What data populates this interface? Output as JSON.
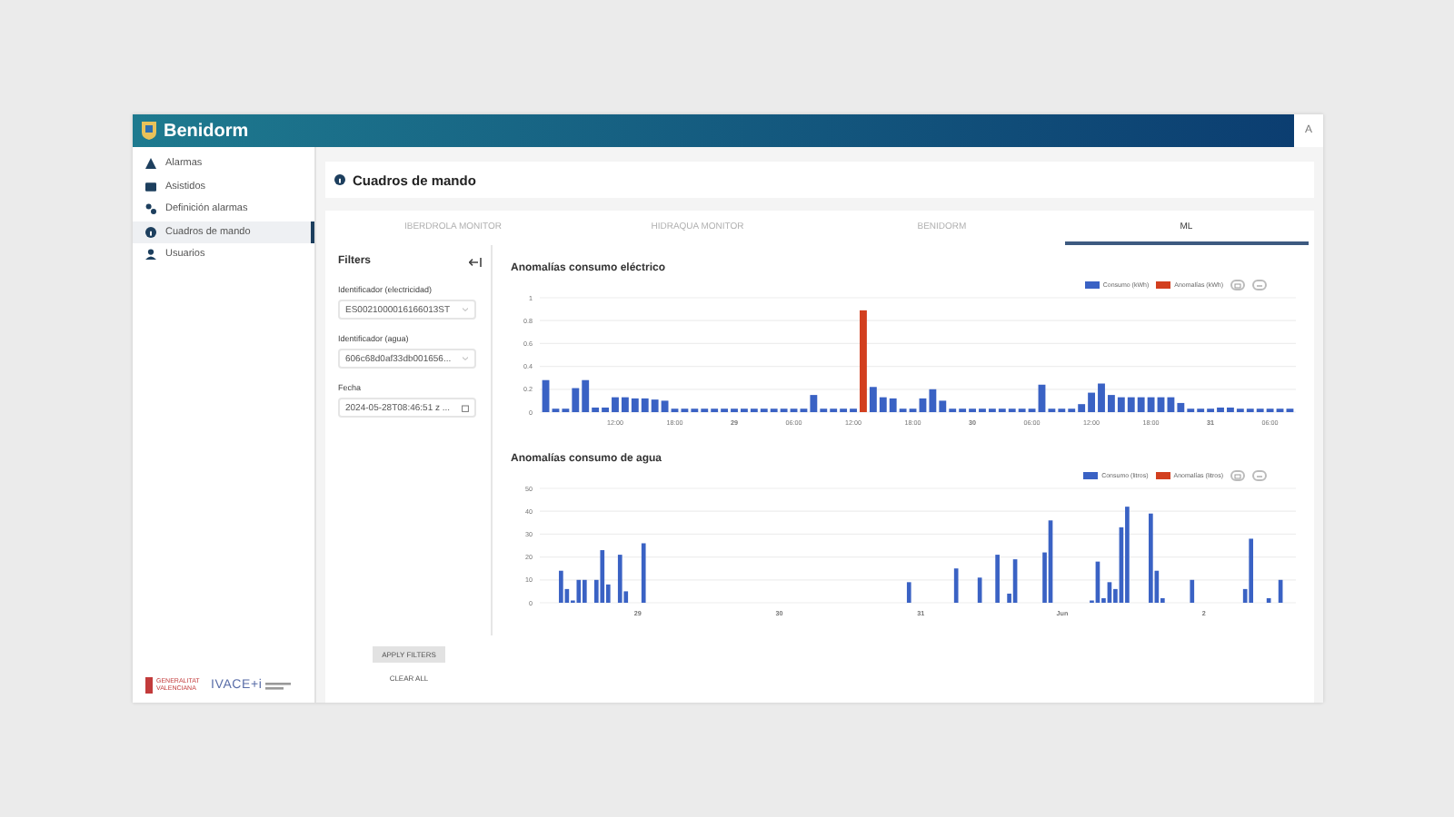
{
  "header": {
    "title": "Benidorm",
    "avatar": "A"
  },
  "sidebar": {
    "items": [
      {
        "label": "Alarmas",
        "kind": "warning",
        "selected": false
      },
      {
        "label": "Asistidos",
        "kind": "card",
        "selected": false
      },
      {
        "label": "Definición alarmas",
        "kind": "gears",
        "selected": false
      },
      {
        "label": "Cuadros de mando",
        "kind": "info",
        "selected": true
      },
      {
        "label": "Usuarios",
        "kind": "user",
        "selected": false
      }
    ],
    "footer_logos": [
      {
        "text": "GENERALITAT VALENCIANA",
        "kind": "gva"
      },
      {
        "text": "IVACE+i",
        "kind": "ivace"
      }
    ]
  },
  "page_title": "Cuadros de mando",
  "tabs": [
    {
      "label": "IBERDROLA MONITOR",
      "selected": false
    },
    {
      "label": "HIDRAQUA MONITOR",
      "selected": false
    },
    {
      "label": "BENIDORM",
      "selected": false
    },
    {
      "label": "ML",
      "selected": true
    }
  ],
  "filters": {
    "title": "Filters",
    "fields": [
      {
        "label": "Identificador (electricidad)",
        "value": "ES0021000016166013ST",
        "kind": "select"
      },
      {
        "label": "Identificador (agua)",
        "value": "606c68d0af33db001656...",
        "kind": "select"
      },
      {
        "label": "Fecha",
        "value": "2024-05-28T08:46:51 z ...",
        "kind": "date"
      }
    ],
    "apply": "APPLY FILTERS",
    "clear": "CLEAR ALL"
  },
  "charts": [
    {
      "chart_data": {
        "type": "bar",
        "title": "Anomalías consumo eléctrico",
        "stacked": true,
        "grid": true,
        "categories": [
          null,
          null,
          null,
          null,
          null,
          null,
          null,
          "12:00",
          null,
          null,
          null,
          null,
          null,
          "18:00",
          null,
          null,
          null,
          null,
          null,
          "29",
          null,
          null,
          null,
          null,
          null,
          "06:00",
          null,
          null,
          null,
          null,
          null,
          "12:00",
          null,
          null,
          null,
          null,
          null,
          "18:00",
          null,
          null,
          null,
          null,
          null,
          "30",
          null,
          null,
          null,
          null,
          null,
          "06:00",
          null,
          null,
          null,
          null,
          null,
          "12:00",
          null,
          null,
          null,
          null,
          null,
          "18:00",
          null,
          null,
          null,
          null,
          null,
          "31",
          null,
          null,
          null,
          null,
          null,
          "06:00",
          null,
          null
        ],
        "series": [
          {
            "name": "Consumo (kWh)",
            "color": "#3a62c4",
            "values": [
              0.28,
              0.03,
              0.03,
              0.21,
              0.28,
              0.04,
              0.04,
              0.13,
              0.13,
              0.12,
              0.12,
              0.11,
              0.1,
              0.03,
              0.03,
              0.03,
              0.03,
              0.03,
              0.03,
              0.03,
              0.03,
              0.03,
              0.03,
              0.03,
              0.03,
              0.03,
              0.03,
              0.15,
              0.03,
              0.03,
              0.03,
              0.03,
              null,
              0.22,
              0.13,
              0.12,
              0.03,
              0.03,
              0.12,
              0.2,
              0.1,
              0.03,
              0.03,
              0.03,
              0.03,
              0.03,
              0.03,
              0.03,
              0.03,
              0.03,
              0.24,
              0.03,
              0.03,
              0.03,
              0.07,
              0.17,
              0.25,
              0.15,
              0.13,
              0.13,
              0.13,
              0.13,
              0.13,
              0.13,
              0.08,
              0.03,
              0.03,
              0.03,
              0.04,
              0.04,
              0.03,
              0.03,
              0.03,
              0.03,
              0.03,
              0.03
            ]
          },
          {
            "name": "Anomalías (kWh)",
            "color": "#d23f1f",
            "values": [
              null,
              null,
              null,
              null,
              null,
              null,
              null,
              null,
              null,
              null,
              null,
              null,
              null,
              null,
              null,
              null,
              null,
              null,
              null,
              null,
              null,
              null,
              null,
              null,
              null,
              null,
              null,
              null,
              null,
              null,
              null,
              null,
              0.89,
              null,
              null,
              null,
              null,
              null,
              null,
              null,
              null,
              null,
              null,
              null,
              null,
              null,
              null,
              null,
              null,
              null,
              null,
              null,
              null,
              null,
              null,
              null,
              null,
              null,
              null,
              null,
              null,
              null,
              null,
              null,
              null,
              null,
              null,
              null,
              null,
              null,
              null,
              null,
              null,
              null,
              null,
              null
            ]
          }
        ],
        "ylim": [
          0,
          1
        ],
        "yticks": [
          {
            "value": 0,
            "label": "0"
          },
          {
            "value": 0.2,
            "label": "0.2"
          },
          {
            "value": 0.4,
            "label": "0.4"
          },
          {
            "value": 0.6,
            "label": "0.6"
          },
          {
            "value": 0.8,
            "label": "0.8"
          },
          {
            "value": 1,
            "label": "1"
          }
        ]
      }
    },
    {
      "chart_data": {
        "type": "bar",
        "title": "Anomalías consumo de agua",
        "stacked": true,
        "grid": true,
        "categories": [
          null,
          null,
          null,
          null,
          null,
          null,
          null,
          null,
          null,
          null,
          null,
          null,
          null,
          null,
          null,
          null,
          "29",
          null,
          null,
          null,
          null,
          null,
          null,
          null,
          null,
          null,
          null,
          null,
          null,
          null,
          null,
          null,
          null,
          null,
          null,
          null,
          null,
          null,
          null,
          null,
          "30",
          null,
          null,
          null,
          null,
          null,
          null,
          null,
          null,
          null,
          null,
          null,
          null,
          null,
          null,
          null,
          null,
          null,
          null,
          null,
          null,
          null,
          null,
          null,
          "31",
          null,
          null,
          null,
          null,
          null,
          null,
          null,
          null,
          null,
          null,
          null,
          null,
          null,
          null,
          null,
          null,
          null,
          null,
          null,
          null,
          null,
          null,
          null,
          "Jun",
          null,
          null,
          null,
          null,
          null,
          null,
          null,
          null,
          null,
          null,
          null,
          null,
          null,
          null,
          null,
          null,
          null,
          null,
          null,
          null,
          null,
          null,
          null,
          "2",
          null,
          null,
          null,
          null,
          null,
          null,
          null,
          null,
          null,
          null,
          null,
          null,
          null,
          null,
          null
        ],
        "series": [
          {
            "name": "Consumo (litros)",
            "color": "#3a62c4",
            "values": [
              null,
              null,
              null,
              14,
              6,
              1,
              10,
              10,
              null,
              10,
              23,
              8,
              null,
              21,
              5,
              null,
              null,
              26,
              null,
              null,
              null,
              null,
              null,
              null,
              null,
              null,
              null,
              null,
              null,
              null,
              null,
              null,
              null,
              null,
              null,
              null,
              null,
              null,
              null,
              null,
              null,
              null,
              null,
              null,
              null,
              null,
              null,
              null,
              null,
              null,
              null,
              null,
              null,
              null,
              null,
              null,
              null,
              null,
              null,
              null,
              null,
              null,
              9,
              null,
              null,
              null,
              null,
              null,
              null,
              null,
              15,
              null,
              null,
              null,
              11,
              null,
              null,
              21,
              null,
              4,
              19,
              null,
              null,
              null,
              null,
              22,
              36,
              null,
              null,
              null,
              null,
              null,
              null,
              1,
              18,
              2,
              9,
              6,
              33,
              42,
              null,
              null,
              null,
              39,
              14,
              2,
              null,
              null,
              null,
              null,
              10,
              null,
              null,
              null,
              null,
              null,
              null,
              null,
              null,
              6,
              28,
              null,
              null,
              2,
              null,
              10,
              null,
              null
            ]
          },
          {
            "name": "Anomalías (litros)",
            "color": "#d23f1f",
            "values": [
              null,
              null,
              null,
              null,
              null,
              null,
              null,
              null,
              null,
              null,
              null,
              null,
              null,
              null,
              null,
              null,
              null,
              null,
              null,
              null,
              null,
              null,
              null,
              null,
              null,
              null,
              null,
              null,
              null,
              null,
              null,
              null,
              null,
              null,
              null,
              null,
              null,
              null,
              null,
              null,
              null,
              null,
              null,
              null,
              null,
              null,
              null,
              null,
              null,
              null,
              null,
              null,
              null,
              null,
              null,
              null,
              null,
              null,
              null,
              null,
              null,
              null,
              null,
              null,
              null,
              null,
              null,
              null,
              null,
              null,
              null,
              null,
              null,
              null,
              null,
              null,
              null,
              null,
              null,
              null,
              null,
              null,
              null,
              null,
              null,
              null,
              null,
              null,
              null,
              null,
              null,
              null,
              null,
              null,
              null,
              null,
              null,
              null,
              null,
              null,
              null,
              null,
              null,
              null,
              null,
              null,
              null,
              null,
              null,
              null,
              null,
              null,
              null,
              null,
              null,
              null,
              null,
              null,
              null,
              null,
              null,
              null,
              null,
              null,
              null,
              null,
              null,
              null
            ]
          }
        ],
        "ylim": [
          0,
          50
        ],
        "yticks": [
          0,
          10,
          20,
          30,
          40,
          50
        ]
      }
    }
  ]
}
